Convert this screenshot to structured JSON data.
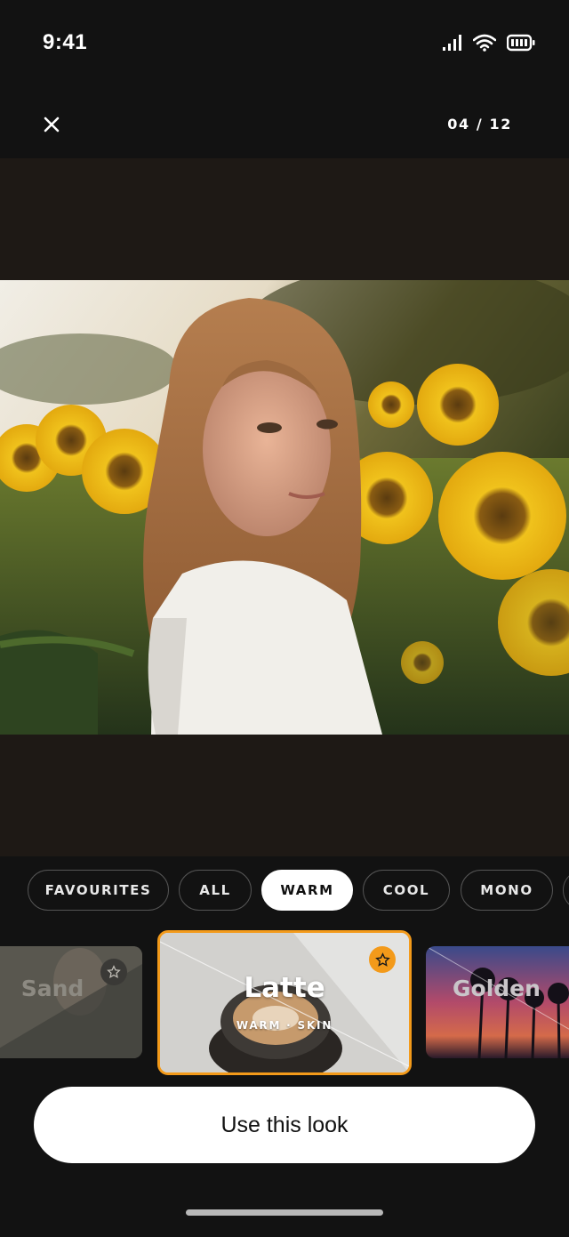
{
  "status_bar": {
    "time": "9:41"
  },
  "header": {
    "counter": "04 / 12"
  },
  "filters": {
    "chips": [
      {
        "label": "FAVOURITES",
        "active": false
      },
      {
        "label": "ALL",
        "active": false
      },
      {
        "label": "WARM",
        "active": true
      },
      {
        "label": "COOL",
        "active": false
      },
      {
        "label": "MONO",
        "active": false
      }
    ]
  },
  "looks": [
    {
      "name": "Sand",
      "favourite": false
    },
    {
      "name": "Latte",
      "subtitle": "WARM · SKIN",
      "favourite": true,
      "selected": true
    },
    {
      "name": "Golden"
    }
  ],
  "cta": {
    "label": "Use this look"
  },
  "colors": {
    "accent": "#f39a1a",
    "background": "#121212",
    "photo_area": "#1e1915"
  }
}
